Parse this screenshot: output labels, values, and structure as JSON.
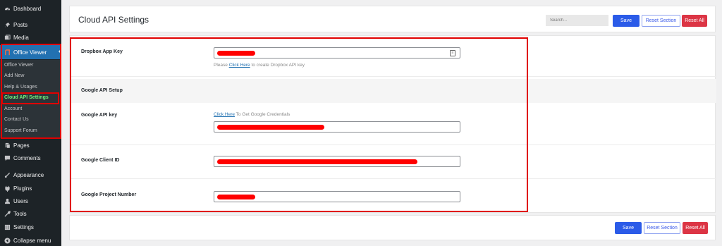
{
  "sidebar": {
    "items": [
      {
        "label": "Dashboard",
        "icon": "dashboard-icon"
      },
      {
        "label": "Posts",
        "icon": "pin-icon"
      },
      {
        "label": "Media",
        "icon": "media-icon"
      },
      {
        "label": "Office Viewer",
        "icon": "office-viewer-icon"
      },
      {
        "label": "Pages",
        "icon": "pages-icon"
      },
      {
        "label": "Comments",
        "icon": "comments-icon"
      },
      {
        "label": "Appearance",
        "icon": "appearance-icon"
      },
      {
        "label": "Plugins",
        "icon": "plugins-icon"
      },
      {
        "label": "Users",
        "icon": "users-icon"
      },
      {
        "label": "Tools",
        "icon": "tools-icon"
      },
      {
        "label": "Settings",
        "icon": "settings-icon"
      },
      {
        "label": "Collapse menu",
        "icon": "collapse-icon"
      }
    ],
    "submenu": [
      {
        "label": "Office Viewer"
      },
      {
        "label": "Add New"
      },
      {
        "label": "Help & Usages"
      },
      {
        "label": "Cloud API Settings"
      },
      {
        "label": "Account"
      },
      {
        "label": "Contact Us"
      },
      {
        "label": "Support Forum"
      }
    ]
  },
  "header": {
    "title": "Cloud API Settings",
    "search_placeholder": "Search...",
    "save_label": "Save",
    "reset_section_label": "Reset Section",
    "reset_all_label": "Reset All"
  },
  "form": {
    "dropbox_label": "Dropbox App Key",
    "dropbox_helper_prefix": "Please ",
    "dropbox_helper_link": "Click Here",
    "dropbox_helper_suffix": " to create Dropbox API key",
    "google_section_title": "Google API Setup",
    "google_api_key_label": "Google API key",
    "google_api_helper_link": "Click Here",
    "google_api_helper_suffix": " To Get Google Credentials",
    "google_client_id_label": "Google Client ID",
    "google_project_number_label": "Google Project Number"
  },
  "footer": {
    "save_label": "Save",
    "reset_section_label": "Reset Section",
    "reset_all_label": "Reset All"
  },
  "colors": {
    "sidebar_bg": "#1d2327",
    "active_menu": "#2271b1",
    "save_button": "#2b5be8",
    "reset_all_button": "#dc3545",
    "highlight_outline": "#e00000",
    "current_submenu_text": "#72ee7a"
  }
}
